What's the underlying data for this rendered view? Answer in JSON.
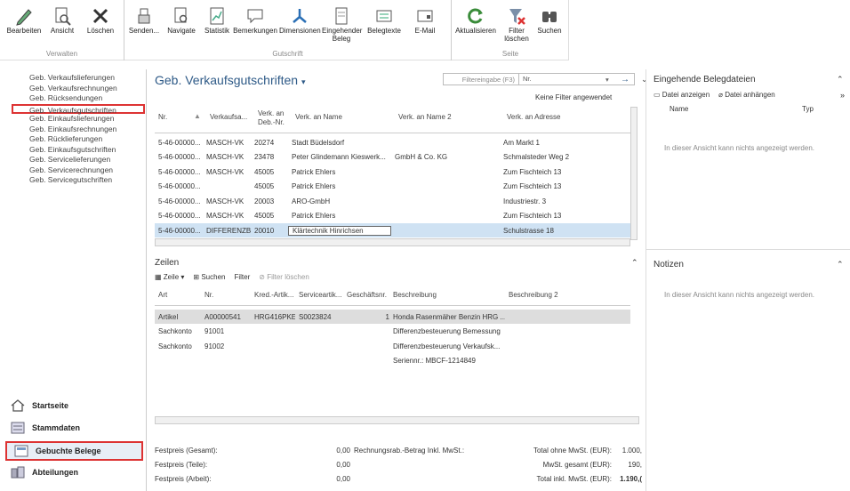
{
  "ribbon": {
    "groups": [
      {
        "label": "Verwalten"
      },
      {
        "label": "Gutschrift"
      },
      {
        "label": "Seite"
      }
    ],
    "buttons": [
      {
        "label": "Bearbeiten",
        "icon": "pencil-icon"
      },
      {
        "label": "Ansicht",
        "icon": "view-icon"
      },
      {
        "label": "Löschen",
        "icon": "delete-icon"
      },
      {
        "label": "Senden...",
        "icon": "send-icon"
      },
      {
        "label": "Navigate",
        "icon": "navigate-icon"
      },
      {
        "label": "Statistik",
        "icon": "statistics-icon"
      },
      {
        "label": "Bemerkungen",
        "icon": "comments-icon"
      },
      {
        "label": "Dimensionen",
        "icon": "dimensions-icon"
      },
      {
        "label": "Eingehender Beleg",
        "icon": "incoming-document-icon"
      },
      {
        "label": "Belegtexte",
        "icon": "document-texts-icon"
      },
      {
        "label": "E-Mail",
        "icon": "email-icon"
      },
      {
        "label": "Aktualisieren",
        "icon": "refresh-icon"
      },
      {
        "label": "Filter löschen",
        "icon": "clear-filter-icon"
      },
      {
        "label": "Suchen",
        "icon": "find-icon"
      }
    ]
  },
  "nav": {
    "items": [
      "Geb. Verkaufslieferungen",
      "Geb. Verkaufsrechnungen",
      "Geb. Rücksendungen",
      "Geb. Verkaufsgutschriften",
      "Geb. Einkaufslieferungen",
      "Geb. Einkaufsrechnungen",
      "Geb. Rücklieferungen",
      "Geb. Einkaufsgutschriften",
      "Geb. Servicelieferungen",
      "Geb. Servicerechnungen",
      "Geb. Servicegutschriften"
    ],
    "buttons": [
      "Startseite",
      "Stammdaten",
      "Gebuchte Belege",
      "Abteilungen"
    ]
  },
  "main": {
    "title": "Geb. Verkaufsgutschriften",
    "filter_label": "Filtereingabe (F3)",
    "filter_field": "Nr.",
    "no_filter": "Keine Filter angewendet",
    "columns": [
      "Nr.",
      "Verkaufsa...",
      "Verk. an Deb.-Nr.",
      "Verk. an Name",
      "Verk. an Name 2",
      "Verk. an Adresse"
    ],
    "rows": [
      [
        "5-46-00000...",
        "MASCH-VK",
        "20274",
        "Stadt Büdelsdorf",
        "",
        "Am Markt 1"
      ],
      [
        "5-46-00000...",
        "MASCH-VK",
        "23478",
        "Peter Glindemann Kieswerk...",
        "GmbH & Co. KG",
        "Schmalsteder Weg 2"
      ],
      [
        "5-46-00000...",
        "MASCH-VK",
        "45005",
        "Patrick Ehlers",
        "",
        "Zum Fischteich 13"
      ],
      [
        "5-46-00000...",
        "",
        "45005",
        "Patrick Ehlers",
        "",
        "Zum Fischteich 13"
      ],
      [
        "5-46-00000...",
        "MASCH-VK",
        "20003",
        "ARO-GmbH",
        "",
        "Industriestr. 3"
      ],
      [
        "5-46-00000...",
        "MASCH-VK",
        "45005",
        "Patrick Ehlers",
        "",
        "Zum Fischteich 13"
      ],
      [
        "5-46-00000...",
        "DIFFERENZB",
        "20010",
        "Klärtechnik Hinrichsen",
        "",
        "Schulstrasse 18"
      ]
    ]
  },
  "zeilen": {
    "title": "Zeilen",
    "toolbar": {
      "zeile": "Zeile",
      "suchen": "Suchen",
      "filter": "Filter",
      "filter_clear": "Filter löschen"
    },
    "columns": [
      "Art",
      "Nr.",
      "Kred.-Artik...",
      "Serviceartik...",
      "Geschäftsnr.",
      "Beschreibung",
      "Beschreibung 2"
    ],
    "rows": [
      [
        "Artikel",
        "A00000541",
        "HRG416PKEA",
        "S0023824",
        "1",
        "Honda Rasenmäher Benzin HRG ...",
        ""
      ],
      [
        "Sachkonto",
        "91001",
        "",
        "",
        "",
        "Differenzbesteuerung Bemessung",
        ""
      ],
      [
        "Sachkonto",
        "91002",
        "",
        "",
        "",
        "Differenzbesteuerung Verkaufsk...",
        ""
      ],
      [
        "",
        "",
        "",
        "",
        "",
        "Seriennr.: MBCF-1214849",
        ""
      ]
    ]
  },
  "totals": {
    "rows": [
      {
        "l1": "Festpreis (Gesamt):",
        "v1": "0,00",
        "l2": "Rechnungsrab.-Betrag Inkl. MwSt.:",
        "l3": "Total ohne MwSt. (EUR):",
        "v3": "1.000,"
      },
      {
        "l1": "Festpreis (Teile):",
        "v1": "0,00",
        "l2": "",
        "l3": "MwSt. gesamt (EUR):",
        "v3": "190,"
      },
      {
        "l1": "Festpreis (Arbeit):",
        "v1": "0,00",
        "l2": "",
        "l3": "Total inkl. MwSt. (EUR):",
        "v3": "1.190,("
      }
    ]
  },
  "right": {
    "incoming_title": "Eingehende Belegdateien",
    "show_file": "Datei anzeigen",
    "attach_file": "Datei anhängen",
    "col_name": "Name",
    "col_type": "Typ",
    "empty1": "In dieser Ansicht kann nichts angezeigt werden.",
    "notes_title": "Notizen",
    "empty2": "In dieser Ansicht kann nichts angezeigt werden."
  }
}
